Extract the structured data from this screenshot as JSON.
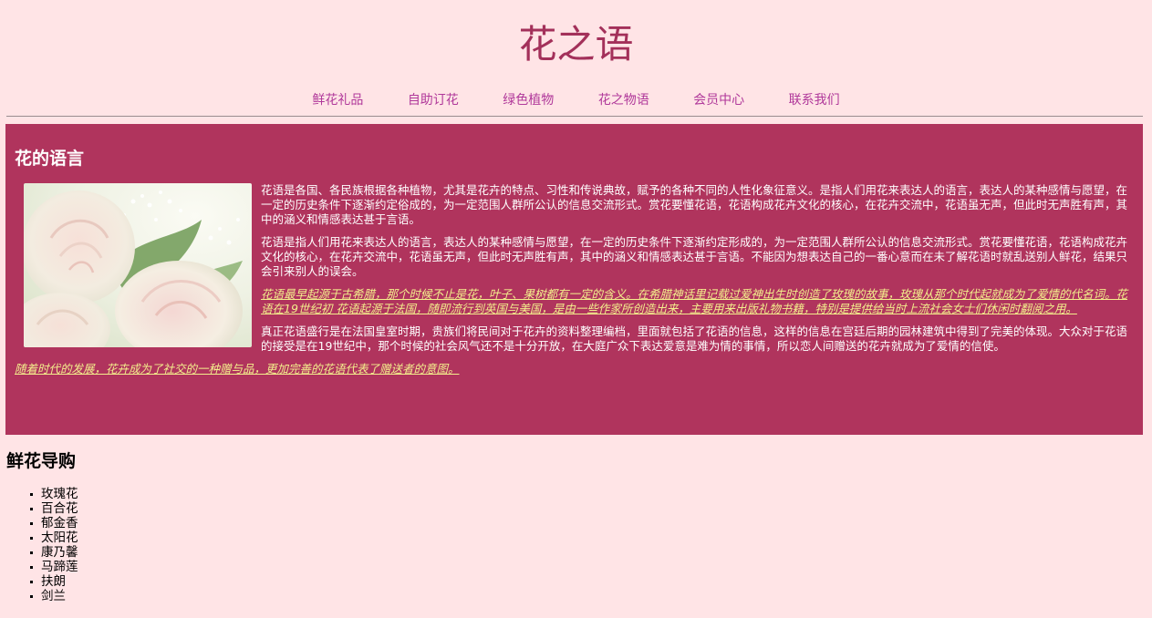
{
  "site": {
    "title": "花之语"
  },
  "nav": {
    "items": [
      {
        "label": "鲜花礼品"
      },
      {
        "label": "自助订花"
      },
      {
        "label": "绿色植物"
      },
      {
        "label": "花之物语"
      },
      {
        "label": "会员中心"
      },
      {
        "label": "联系我们"
      }
    ],
    "link_color": "#b0389a"
  },
  "feature": {
    "heading": "花的语言",
    "image_icon": "rose-photo",
    "background_color": "#b0345d",
    "quote_color": "#f3ee8c",
    "paragraphs": [
      "花语是各国、各民族根据各种植物，尤其是花卉的特点、习性和传说典故，赋予的各种不同的人性化象征意义。是指人们用花来表达人的语言，表达人的某种感情与愿望，在一定的历史条件下逐渐约定俗成的，为一定范围人群所公认的信息交流形式。赏花要懂花语，花语构成花卉文化的核心，在花卉交流中，花语虽无声，但此时无声胜有声，其中的涵义和情感表达甚于言语。",
      "花语是指人们用花来表达人的语言，表达人的某种感情与愿望，在一定的历史条件下逐渐约定形成的，为一定范围人群所公认的信息交流形式。赏花要懂花语，花语构成花卉文化的核心，在花卉交流中，花语虽无声，但此时无声胜有声，其中的涵义和情感表达甚于言语。不能因为想表达自己的一番心意而在未了解花语时就乱送别人鲜花，结果只会引来别人的误会。",
      "花语最早起源于古希腊，那个时候不止是花，叶子、果树都有一定的含义。在希腊神话里记载过爱神出生时创造了玫瑰的故事，玫瑰从那个时代起就成为了爱情的代名词。花语在19世纪初 花语起源于法国，随即流行到英国与美国，是由一些作家所创造出来，主要用来出版礼物书籍，特别是提供给当时上流社会女士们休闲时翻阅之用。",
      "真正花语盛行是在法国皇室时期，贵族们将民间对于花卉的资料整理编档，里面就包括了花语的信息，这样的信息在宫廷后期的园林建筑中得到了完美的体现。大众对于花语的接受是在19世纪中，那个时候的社会风气还不是十分开放，在大庭广众下表达爱意是难为情的事情，所以恋人间赠送的花卉就成为了爱情的信使。",
      "随着时代的发展，花卉成为了社交的一种赠与品，更加完善的花语代表了赠送者的意图。"
    ]
  },
  "guide": {
    "heading": "鲜花导购",
    "items": [
      "玫瑰花",
      "百合花",
      "郁金香",
      "太阳花",
      "康乃馨",
      "马蹄莲",
      "扶朗",
      "剑兰"
    ]
  }
}
